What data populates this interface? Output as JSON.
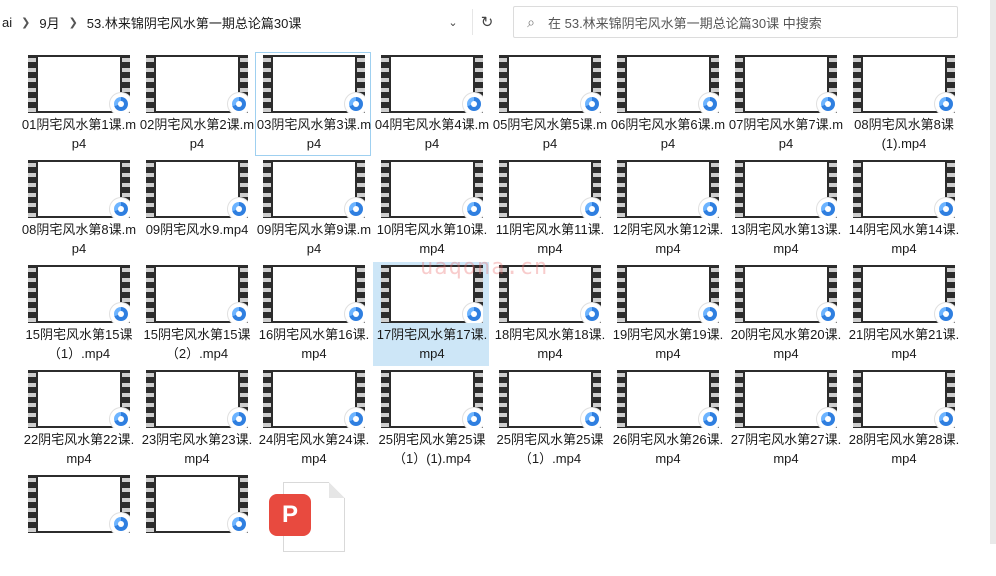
{
  "breadcrumb": {
    "items": [
      "ai",
      "9月",
      "53.林来锦阴宅风水第一期总论篇30课"
    ]
  },
  "search": {
    "placeholder": "在 53.林来锦阴宅风水第一期总论篇30课 中搜索"
  },
  "watermark": "uaqona.cn",
  "files": [
    {
      "name": "01阴宅风水第1课.mp4",
      "thumb": "blank"
    },
    {
      "name": "02阴宅风水第2课.mp4",
      "thumb": "blank"
    },
    {
      "name": "03阴宅风水第3课.mp4",
      "thumb": "blank",
      "state": "hover"
    },
    {
      "name": "04阴宅风水第4课.mp4",
      "thumb": "blank"
    },
    {
      "name": "05阴宅风水第5课.mp4",
      "thumb": "blank"
    },
    {
      "name": "06阴宅风水第6课.mp4",
      "thumb": "blank"
    },
    {
      "name": "07阴宅风水第7课.mp4",
      "thumb": "blank"
    },
    {
      "name": "08阴宅风水第8课(1).mp4",
      "thumb": "blank"
    },
    {
      "name": "08阴宅风水第8课.mp4",
      "thumb": "wave"
    },
    {
      "name": "09阴宅风水9.mp4",
      "thumb": "blank"
    },
    {
      "name": "09阴宅风水第9课.mp4",
      "thumb": "plant"
    },
    {
      "name": "10阴宅风水第10课.mp4",
      "thumb": "board"
    },
    {
      "name": "11阴宅风水第11课.mp4",
      "thumb": "mtn1"
    },
    {
      "name": "12阴宅风水第12课.mp4",
      "thumb": "river"
    },
    {
      "name": "13阴宅风水第13课.mp4",
      "thumb": "river2"
    },
    {
      "name": "14阴宅风水第14课.mp4",
      "thumb": "mtn2"
    },
    {
      "name": "15阴宅风水第15课（1）.mp4",
      "thumb": "lake"
    },
    {
      "name": "15阴宅风水第15课（2）.mp4",
      "thumb": "sketch"
    },
    {
      "name": "16阴宅风水第16课.mp4",
      "thumb": "hill"
    },
    {
      "name": "17阴宅风水第17课.mp4",
      "thumb": "draw",
      "state": "selected"
    },
    {
      "name": "18阴宅风水第18课.mp4",
      "thumb": "gray"
    },
    {
      "name": "19阴宅风水第19课.mp4",
      "thumb": "draw"
    },
    {
      "name": "20阴宅风水第20课.mp4",
      "thumb": "field"
    },
    {
      "name": "21阴宅风水第21课.mp4",
      "thumb": "field"
    },
    {
      "name": "22阴宅风水第22课.mp4",
      "thumb": "dusk"
    },
    {
      "name": "23阴宅风水第23课.mp4",
      "thumb": "pond"
    },
    {
      "name": "24阴宅风水第24课.mp4",
      "thumb": "dark"
    },
    {
      "name": "25阴宅风水第25课（1）(1).mp4",
      "thumb": "door"
    },
    {
      "name": "25阴宅风水第25课（1）.mp4",
      "thumb": "door"
    },
    {
      "name": "26阴宅风水第26课.mp4",
      "thumb": "text"
    },
    {
      "name": "27阴宅风水第27课.mp4",
      "thumb": "notes"
    },
    {
      "name": "28阴宅风水第28课.mp4",
      "thumb": "noteb"
    },
    {
      "name": "",
      "thumb": "notes"
    },
    {
      "name": "",
      "thumb": "noteb"
    }
  ],
  "pdf_file": {
    "icon": "pdf-icon"
  }
}
